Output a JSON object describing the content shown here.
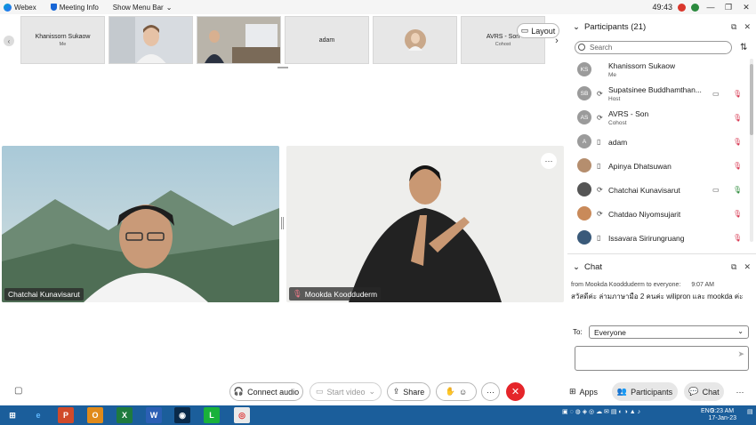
{
  "topbar": {
    "app_name": "Webex",
    "meeting_info": "Meeting Info",
    "show_menu_bar": "Show Menu Bar",
    "timer": "49:43",
    "minimize_glyph": "—",
    "restore_glyph": "❐",
    "close_glyph": "✕"
  },
  "filmstrip": {
    "tiles": [
      {
        "name": "Khanissorn Sukaow",
        "sub": "Me"
      },
      {
        "name": "",
        "sub": ""
      },
      {
        "name": "",
        "sub": ""
      },
      {
        "name": "adam",
        "sub": ""
      },
      {
        "name": "",
        "sub": ""
      },
      {
        "name": "AVRS - Son",
        "sub": "Cohost"
      }
    ],
    "layout_label": "Layout",
    "prev_glyph": "‹",
    "next_glyph": "›"
  },
  "videos": {
    "left_label": "Chatchai Kunavisarut",
    "right_label": "Mookda Koodduderm",
    "more_glyph": "···"
  },
  "participants": {
    "title": "Participants (21)",
    "search_placeholder": "Search",
    "items": [
      {
        "initials": "KS",
        "name": "Khanissorn Sukaow",
        "role": "Me",
        "status": "",
        "video": "",
        "mic": ""
      },
      {
        "initials": "SB",
        "name": "Supatsinee Buddhamthan...",
        "role": "Host",
        "status": "⟳",
        "video": "▭",
        "mic": "🎙"
      },
      {
        "initials": "AS",
        "name": "AVRS - Son",
        "role": "Cohost",
        "status": "⟳",
        "video": "",
        "mic": "🎙"
      },
      {
        "initials": "A",
        "name": "adam",
        "role": "",
        "status": "▯",
        "video": "",
        "mic": "🎙"
      },
      {
        "initials": "",
        "name": "Apinya Dhatsuwan",
        "role": "",
        "status": "▯",
        "video": "",
        "mic": "🎙"
      },
      {
        "initials": "",
        "name": "Chatchai Kunavisarut",
        "role": "",
        "status": "⟳",
        "video": "▭",
        "mic": "🎙"
      },
      {
        "initials": "",
        "name": "Chatdao Niyomsujarit",
        "role": "",
        "status": "⟳",
        "video": "",
        "mic": "🎙"
      },
      {
        "initials": "",
        "name": "Issavara Sirirungruang",
        "role": "",
        "status": "▯",
        "video": "",
        "mic": "🎙"
      }
    ]
  },
  "chat": {
    "title": "Chat",
    "message_from": "from Mookda Koodduderm to everyone:",
    "message_time": "9:07 AM",
    "message_text": "สวัสดีค่ะ ล่ามภาษามือ 2 คนค่ะ wilipron และ mookda ค่ะ",
    "to_label": "To:",
    "to_value": "Everyone"
  },
  "controls": {
    "connect_audio": "Connect audio",
    "start_video": "Start video",
    "share": "Share",
    "apps": "Apps",
    "participants": "Participants",
    "chat": "Chat",
    "end_glyph": "✕",
    "more_glyph": "···"
  },
  "taskbar": {
    "language": "ENG",
    "time": "9:23 AM",
    "date": "17-Jan-23"
  },
  "colors": {
    "accent_blue": "#1766d6",
    "end_red": "#e5252a",
    "taskbar": "#1b5e9b"
  }
}
